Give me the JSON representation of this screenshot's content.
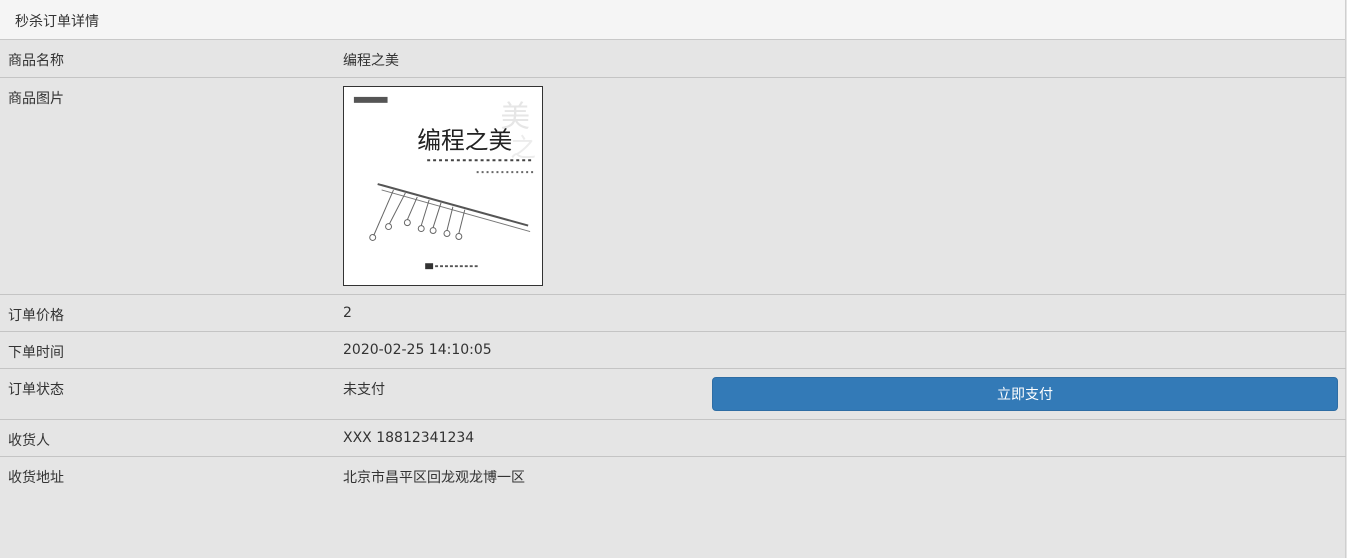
{
  "panel": {
    "title": "秒杀订单详情"
  },
  "rows": {
    "goods_name": {
      "label": "商品名称",
      "value": "编程之美"
    },
    "goods_img": {
      "label": "商品图片",
      "alt": "编程之美",
      "cover_title": "编程之美"
    },
    "order_price": {
      "label": "订单价格",
      "value": "2"
    },
    "create_time": {
      "label": "下单时间",
      "value": "2020-02-25 14:10:05"
    },
    "order_status": {
      "label": "订单状态",
      "value": "未支付",
      "pay_button": "立即支付"
    },
    "receiver": {
      "label": "收货人",
      "value": "XXX 18812341234"
    },
    "address": {
      "label": "收货地址",
      "value": "北京市昌平区回龙观龙博一区"
    }
  },
  "colors": {
    "page_bg": "#e5e5e5",
    "heading_bg": "#f5f5f5",
    "primary_button": "#337ab7",
    "border": "#c4c4c4"
  },
  "icons": {
    "book_cover": "book-cover-image"
  }
}
